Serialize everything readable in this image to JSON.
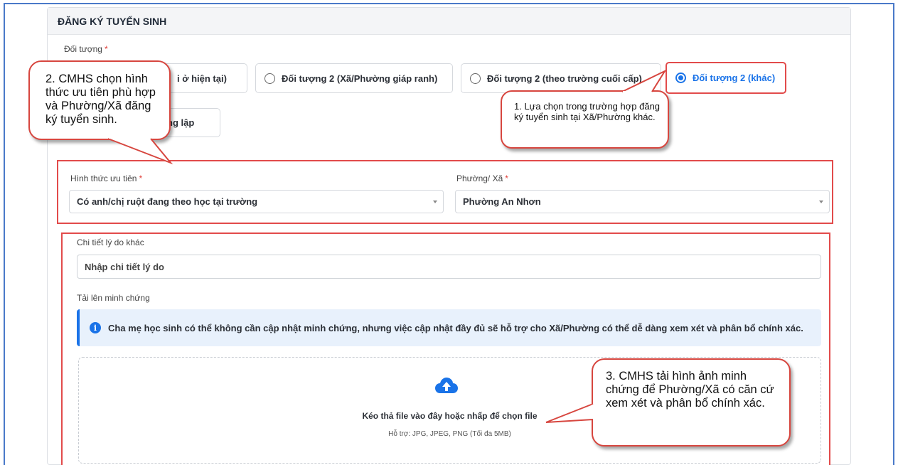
{
  "card": {
    "title": "ĐĂNG KÝ TUYỂN SINH"
  },
  "target": {
    "label": "Đối tượng",
    "required_mark": "*",
    "options": [
      {
        "label": "Đối tượng 1 (Nơi ở hiện tại)",
        "visible_fragment": "i ở hiện tại)"
      },
      {
        "label": "Đối tượng 2 (Xã/Phường giáp ranh)"
      },
      {
        "label": "Đối tượng 2 (theo trường cuối cấp)",
        "visible_fragment": "Đối tượng 2 (theo trường cuối cấp)"
      },
      {
        "label": "Đối tượng 2 (khác)",
        "selected": true
      }
    ],
    "second_row_fragment": "ng lập"
  },
  "priority": {
    "label": "Hình thức ưu tiên",
    "required_mark": "*",
    "value": "Có anh/chị ruột đang theo học tại trường"
  },
  "ward": {
    "label": "Phường/ Xã",
    "required_mark": "*",
    "value": "Phường An Nhơn"
  },
  "details": {
    "label": "Chi tiết lý do khác",
    "placeholder": "Nhập chi tiết lý do"
  },
  "evidence": {
    "label": "Tải lên minh chứng",
    "info": "Cha mẹ học sinh có thể không cần cập nhật minh chứng, nhưng việc cập nhật đầy đủ sẽ hỗ trợ cho Xã/Phường có thể dễ dàng xem xét và phân bổ chính xác.",
    "drop_title": "Kéo thả file vào đây hoặc nhấp để chọn file",
    "drop_hint": "Hỗ trợ: JPG, JPEG, PNG (Tối đa 5MB)"
  },
  "callouts": {
    "c1": "1. Lựa chọn trong trường hợp đăng ký tuyển sinh tại Xã/Phường khác.",
    "c2": "2. CMHS chọn hình thức ưu tiên phù hợp và Phường/Xã đăng ký tuyển sinh.",
    "c3": "3. CMHS tải hình ảnh minh chứng để Phường/Xã có căn cứ xem xét và phân bổ chính xác."
  },
  "colors": {
    "accent": "#1a73e8",
    "highlight": "#e24b4b",
    "info_bg": "#e8f1fc"
  },
  "icons": {
    "info": "info-icon",
    "upload": "cloud-upload-icon",
    "caret": "caret-down-icon"
  }
}
